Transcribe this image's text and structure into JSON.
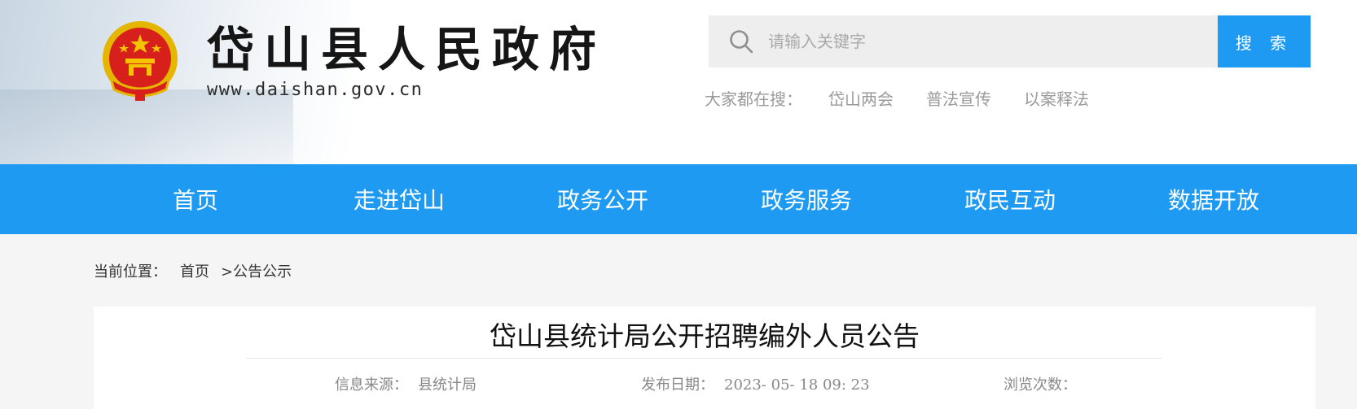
{
  "header": {
    "site_title": "岱山县人民政府",
    "site_url": "www.daishan.gov.cn",
    "search": {
      "placeholder": "请输入关键字",
      "button_label": "搜 索"
    },
    "hot_search": {
      "label": "大家都在搜：",
      "items": [
        "岱山两会",
        "普法宣传",
        "以案释法"
      ]
    }
  },
  "nav": {
    "items": [
      "首页",
      "走进岱山",
      "政务公开",
      "政务服务",
      "政民互动",
      "数据开放"
    ]
  },
  "breadcrumb": {
    "label": "当前位置：",
    "home": "首页",
    "current": ">公告公示"
  },
  "article": {
    "title": "岱山县统计局公开招聘编外人员公告",
    "source_label": "信息来源：",
    "source_value": "县统计局",
    "date_label": "发布日期：",
    "date_value": "2023- 05- 18 09: 23",
    "views_label": "浏览次数："
  },
  "colors": {
    "primary": "#1e9af3",
    "emblem_red": "#d7201b",
    "emblem_gold": "#f5c400"
  }
}
